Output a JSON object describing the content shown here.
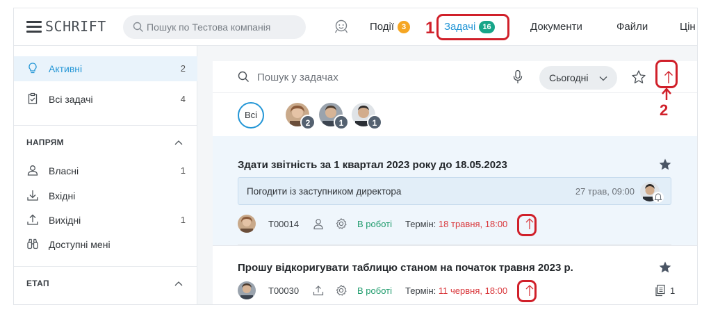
{
  "header": {
    "logo": "SCHRIFT",
    "search_placeholder": "Пошук по Тестова компанія",
    "nav": [
      {
        "label": "Події",
        "badge": "3"
      },
      {
        "label": "Задачі",
        "badge": "16"
      },
      {
        "label": "Документи"
      },
      {
        "label": "Файли"
      },
      {
        "label": "Цін"
      }
    ]
  },
  "annotations": [
    "1",
    "2"
  ],
  "sidebar": {
    "top_items": [
      {
        "label": "Активні",
        "count": "2",
        "icon": "lightbulb-icon"
      },
      {
        "label": "Всі задачі",
        "count": "4",
        "icon": "clipboard-check-icon"
      }
    ],
    "section_direction": {
      "title": "НАПРЯМ",
      "items": [
        {
          "label": "Власні",
          "count": "1",
          "icon": "person-icon"
        },
        {
          "label": "Вхідні",
          "count": "",
          "icon": "download-icon"
        },
        {
          "label": "Вихідні",
          "count": "1",
          "icon": "upload-icon"
        },
        {
          "label": "Доступні мені",
          "count": "",
          "icon": "binoculars-icon"
        }
      ]
    },
    "section_stage": {
      "title": "ЕТАП"
    }
  },
  "main": {
    "search_placeholder": "Пошук у задачах",
    "date_filter": "Сьогодні",
    "all_label": "Всі",
    "avatar_counts": [
      "2",
      "1",
      "1"
    ],
    "tasks": [
      {
        "title": "Здати звітність за 1 квартал 2023 року до 18.05.2023",
        "subtask": {
          "label": "Погодити із заступником директора",
          "time": "27 трав, 09:00"
        },
        "number": "T00014",
        "status": "В роботі",
        "term_label": "Термін:",
        "term_date": "18 травня, 18:00"
      },
      {
        "title": "Прошу відкоригувати таблицю станом на початок травня 2023 р.",
        "number": "T00030",
        "status": "В роботі",
        "term_label": "Термін:",
        "term_date": "11 червня, 18:00",
        "docs_count": "1"
      }
    ]
  },
  "colors": {
    "accent": "#2396d6",
    "badge_orange": "#f5a623",
    "badge_teal": "#17a589",
    "status_green": "#1e9b6c",
    "deadline_red": "#d9373b",
    "annotation_red": "#d0202a"
  }
}
